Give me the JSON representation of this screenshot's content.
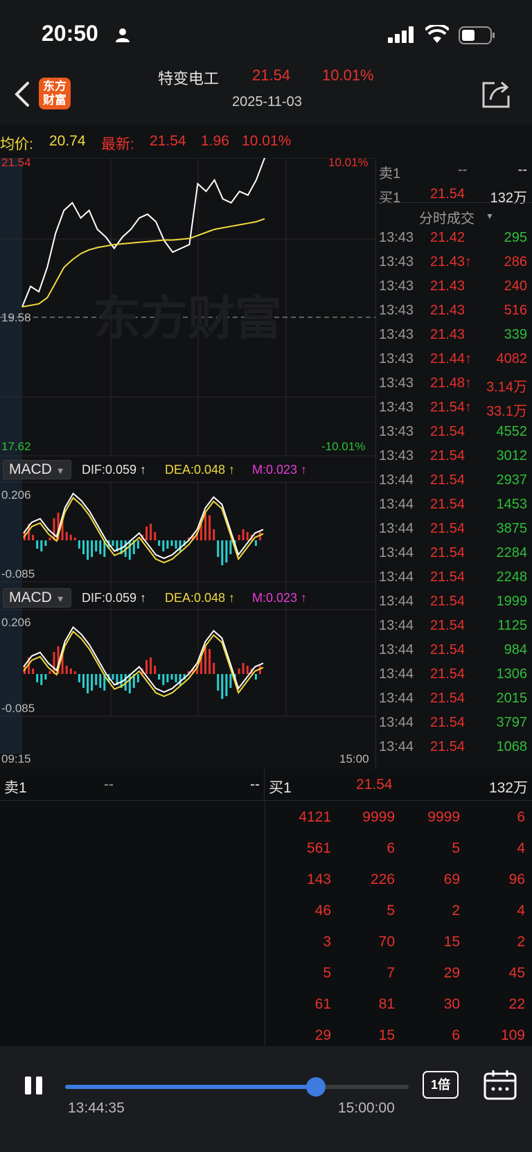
{
  "status_bar": {
    "time": "20:50"
  },
  "header": {
    "stock_name": "特变电工",
    "price": "21.54",
    "change_pct": "10.01%",
    "date": "2025-11-03",
    "logo_text": "东方财富"
  },
  "summary": {
    "avg_label": "均价:",
    "avg_value": "20.74",
    "latest_label": "最新:",
    "latest_price": "21.54",
    "latest_change": "1.96",
    "latest_pct": "10.01%"
  },
  "chart": {
    "y_max_label": "21.54",
    "y_max_pct": "10.01%",
    "y_mid_label": "19.58",
    "y_min_label": "17.62",
    "y_min_pct": "-10.01%",
    "watermark": "东方财富",
    "x_start": "09:15",
    "x_end": "15:00"
  },
  "chart_data": {
    "type": "line",
    "ylim": [
      17.62,
      21.54
    ],
    "series": [
      {
        "values": [
          19.58,
          19.85,
          19.78,
          20.1,
          20.55,
          20.85,
          20.95,
          20.75,
          20.85,
          20.6,
          20.5,
          20.35,
          20.5,
          20.6,
          20.75,
          20.8,
          20.7,
          20.45,
          20.3,
          20.35,
          20.4,
          21.2,
          21.1,
          21.25,
          21.0,
          20.95,
          21.1,
          21.05,
          21.25,
          21.54
        ]
      },
      {
        "values": [
          19.58,
          19.6,
          19.62,
          19.7,
          19.9,
          20.1,
          20.2,
          20.28,
          20.33,
          20.36,
          20.38,
          20.4,
          20.41,
          20.42,
          20.43,
          20.44,
          20.45,
          20.46,
          20.46,
          20.47,
          20.48,
          20.52,
          20.56,
          20.6,
          20.62,
          20.64,
          20.66,
          20.68,
          20.7,
          20.74
        ]
      }
    ]
  },
  "macd1": {
    "name": "MACD",
    "dif": "DIF:0.059 ↑",
    "dea": "DEA:0.048 ↑",
    "m": "M:0.023 ↑",
    "top": "0.206",
    "bottom": "-0.085"
  },
  "macd2": {
    "name": "MACD",
    "dif": "DIF:0.059 ↑",
    "dea": "DEA:0.048 ↑",
    "m": "M:0.023 ↑",
    "top": "0.206",
    "bottom": "-0.085"
  },
  "ticks": {
    "sell1_label": "卖1",
    "sell1_price": "--",
    "sell1_vol": "--",
    "buy1_label": "买1",
    "buy1_price": "21.54",
    "buy1_vol": "132万",
    "dropdown_label": "分时成交",
    "rows": [
      {
        "time": "13:43",
        "price": "21.42",
        "vol": "295",
        "vcolor": "#2fbf3a"
      },
      {
        "time": "13:43",
        "price": "21.43↑",
        "vol": "286",
        "vcolor": "#e8322c"
      },
      {
        "time": "13:43",
        "price": "21.43",
        "vol": "240",
        "vcolor": "#e8322c"
      },
      {
        "time": "13:43",
        "price": "21.43",
        "vol": "516",
        "vcolor": "#e8322c"
      },
      {
        "time": "13:43",
        "price": "21.43",
        "vol": "339",
        "vcolor": "#2fbf3a"
      },
      {
        "time": "13:43",
        "price": "21.44↑",
        "vol": "4082",
        "vcolor": "#e8322c"
      },
      {
        "time": "13:43",
        "price": "21.48↑",
        "vol": "3.14万",
        "vcolor": "#e8322c"
      },
      {
        "time": "13:43",
        "price": "21.54↑",
        "vol": "33.1万",
        "vcolor": "#e8322c"
      },
      {
        "time": "13:43",
        "price": "21.54",
        "vol": "4552",
        "vcolor": "#2fbf3a"
      },
      {
        "time": "13:43",
        "price": "21.54",
        "vol": "3012",
        "vcolor": "#2fbf3a"
      },
      {
        "time": "13:44",
        "price": "21.54",
        "vol": "2937",
        "vcolor": "#2fbf3a"
      },
      {
        "time": "13:44",
        "price": "21.54",
        "vol": "1453",
        "vcolor": "#2fbf3a"
      },
      {
        "time": "13:44",
        "price": "21.54",
        "vol": "3875",
        "vcolor": "#2fbf3a"
      },
      {
        "time": "13:44",
        "price": "21.54",
        "vol": "2284",
        "vcolor": "#2fbf3a"
      },
      {
        "time": "13:44",
        "price": "21.54",
        "vol": "2248",
        "vcolor": "#2fbf3a"
      },
      {
        "time": "13:44",
        "price": "21.54",
        "vol": "1999",
        "vcolor": "#2fbf3a"
      },
      {
        "time": "13:44",
        "price": "21.54",
        "vol": "1125",
        "vcolor": "#2fbf3a"
      },
      {
        "time": "13:44",
        "price": "21.54",
        "vol": "984",
        "vcolor": "#2fbf3a"
      },
      {
        "time": "13:44",
        "price": "21.54",
        "vol": "1306",
        "vcolor": "#2fbf3a"
      },
      {
        "time": "13:44",
        "price": "21.54",
        "vol": "2015",
        "vcolor": "#2fbf3a"
      },
      {
        "time": "13:44",
        "price": "21.54",
        "vol": "3797",
        "vcolor": "#2fbf3a"
      },
      {
        "time": "13:44",
        "price": "21.54",
        "vol": "1068",
        "vcolor": "#2fbf3a"
      }
    ]
  },
  "orderbook": {
    "sell_label": "卖1",
    "sell_price": "--",
    "sell_vol": "--",
    "buy_label": "买1",
    "buy_price": "21.54",
    "buy_vol": "132万",
    "queue": [
      [
        "4121",
        "9999",
        "9999",
        "6"
      ],
      [
        "561",
        "6",
        "5",
        "4"
      ],
      [
        "143",
        "226",
        "69",
        "96"
      ],
      [
        "46",
        "5",
        "2",
        "4"
      ],
      [
        "3",
        "70",
        "15",
        "2"
      ],
      [
        "5",
        "7",
        "29",
        "45"
      ],
      [
        "61",
        "81",
        "30",
        "22"
      ],
      [
        "29",
        "15",
        "6",
        "109"
      ]
    ]
  },
  "player": {
    "current_time": "13:44:35",
    "end_time": "15:00:00",
    "speed": "1倍",
    "progress": 0.73
  }
}
